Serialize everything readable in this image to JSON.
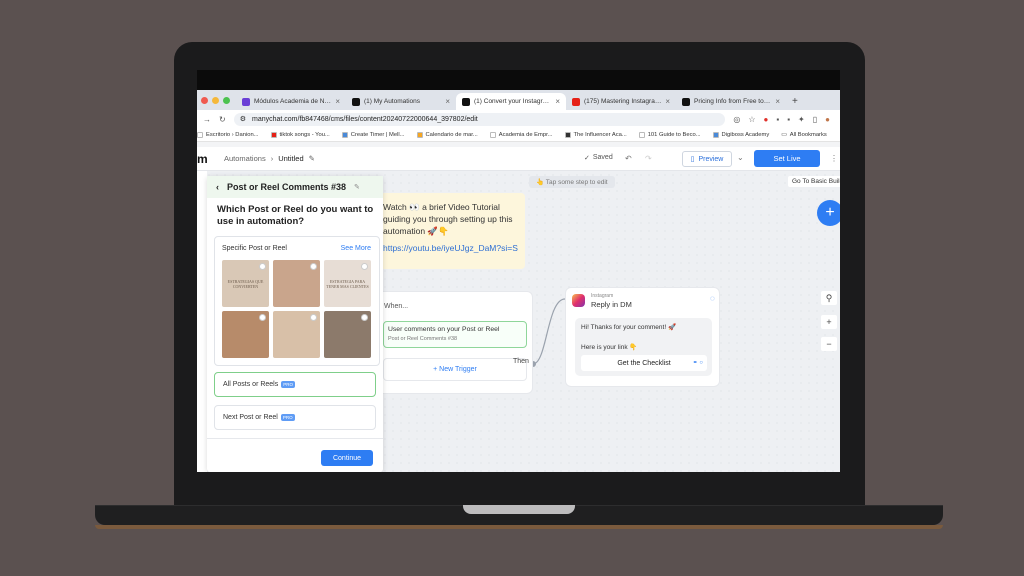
{
  "browser": {
    "tabs": [
      {
        "label": "Módulos Academia de Negocios",
        "active": false,
        "fav_color": "#6a3fd6"
      },
      {
        "label": "(1) My Automations",
        "active": false,
        "fav_color": "#111111"
      },
      {
        "label": "(1) Convert your Instagram C",
        "active": true,
        "fav_color": "#111111"
      },
      {
        "label": "(175) Mastering Instagram: A",
        "active": false,
        "fav_color": "#e62117"
      },
      {
        "label": "Pricing Info from Free to Pro",
        "active": false,
        "fav_color": "#111111"
      }
    ],
    "new_tab": "+",
    "url": "manychat.com/fb847468/cms/files/content20240722000644_397802/edit",
    "bookmarks": [
      {
        "label": "Escritorio › Danion...",
        "color": "#ffffff"
      },
      {
        "label": "tiktok songs - You...",
        "color": "#e62117"
      },
      {
        "label": "Create Timer | Mell...",
        "color": "#4a8ad8"
      },
      {
        "label": "Calendario de mar...",
        "color": "#f5a623"
      },
      {
        "label": "Academia de Empr...",
        "color": "#ffffff"
      },
      {
        "label": "The Influencer Aca...",
        "color": "#333333"
      },
      {
        "label": "101 Guide to Beco...",
        "color": "#ffffff"
      },
      {
        "label": "Digiboss Academy",
        "color": "#4a8ad8"
      }
    ],
    "all_bookmarks": "All Bookmarks"
  },
  "app": {
    "logo": "m",
    "breadcrumb_root": "Automations",
    "breadcrumb_sep": "›",
    "breadcrumb_current": "Untitled",
    "saved": "Saved",
    "preview": "Preview",
    "set_live": "Set Live"
  },
  "canvas": {
    "hint": "👆 Tap some step to edit",
    "basic_builder": "Go To Basic Builder",
    "note_lines": [
      "Watch 👀 a brief Video Tutorial",
      "guiding you through setting up this",
      "automation 🚀👇"
    ],
    "note_link": "https://youtu.be/iyeUJgz_DaM?si=S",
    "when": "When...",
    "trigger_title": "User comments on your Post or Reel",
    "trigger_sub": "Post or Reel Comments #38",
    "new_trigger": "+ New Trigger",
    "then": "Then",
    "dm_platform": "Instagram",
    "dm_title": "Reply in DM",
    "dm_msg_1": "Hi! Thanks for your comment! 🚀",
    "dm_msg_2": "Here is your link 👇",
    "dm_button": "Get the Checklist"
  },
  "panel": {
    "title": "Post or Reel Comments #38",
    "question": "Which Post or Reel do you want to use in automation?",
    "specific_label": "Specific Post or Reel",
    "see_more": "See More",
    "thumbs": [
      {
        "text": "ESTRATEGIAS QUE CONVIERTEN",
        "bg": "#d9c8b6"
      },
      {
        "text": "",
        "bg": "#c9a58c"
      },
      {
        "text": "ESTRATEGIA PARA TENER MAS CLIENTES",
        "bg": "#e7ddd5"
      },
      {
        "text": "",
        "bg": "#b78b6a"
      },
      {
        "text": "",
        "bg": "#d8c0a8"
      },
      {
        "text": "",
        "bg": "#8c7a6b"
      }
    ],
    "opt_all": "All Posts or Reels",
    "opt_next": "Next Post or Reel",
    "pro": "PRO",
    "continue": "Continue"
  }
}
